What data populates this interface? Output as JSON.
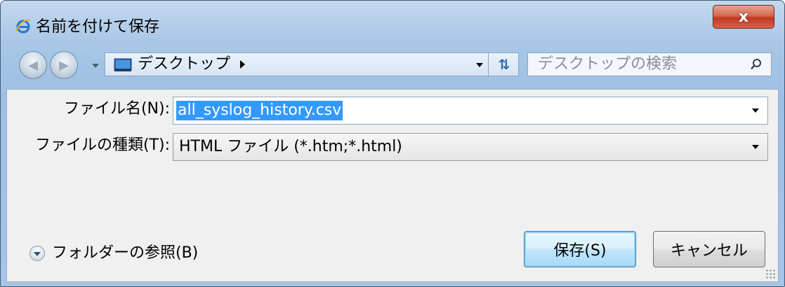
{
  "window": {
    "title": "名前を付けて保存",
    "close_label": "x"
  },
  "navbar": {
    "location": "デスクトップ",
    "search_placeholder": "デスクトップの検索"
  },
  "form": {
    "filename_label": "ファイル名(N):",
    "filename_value": "all_syslog_history.csv",
    "filetype_label": "ファイルの種類(T):",
    "filetype_value": "HTML ファイル (*.htm;*.html)"
  },
  "footer": {
    "browse_label": "フォルダーの参照(B)",
    "save_label": "保存(S)",
    "cancel_label": "キャンセル"
  },
  "colors": {
    "selection": "#3399ff",
    "close_button": "#c1381f",
    "primary_button_border": "#3c7fb1"
  },
  "icons": {
    "title": "internet-explorer-icon",
    "back": "back-arrow-icon",
    "forward": "forward-arrow-icon",
    "location": "desktop-icon",
    "refresh": "refresh-icon",
    "search": "search-icon",
    "browse": "expand-chevron-icon"
  }
}
